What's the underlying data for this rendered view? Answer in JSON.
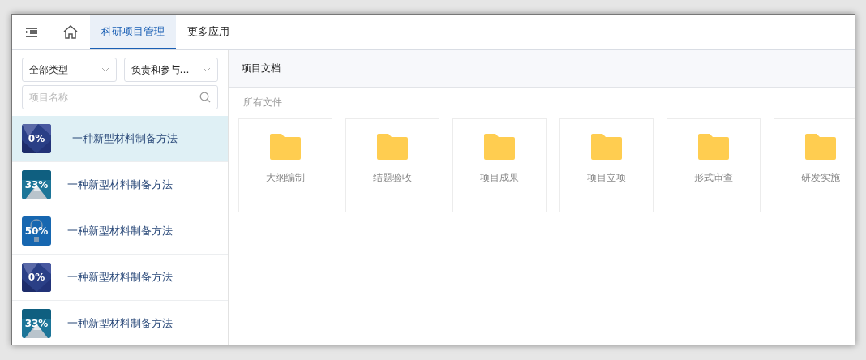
{
  "nav": {
    "tabs": [
      {
        "label": "科研项目管理",
        "selected": true
      },
      {
        "label": "更多应用",
        "selected": false
      }
    ]
  },
  "sidebar": {
    "filters": [
      {
        "value": "全部类型"
      },
      {
        "value": "负责和参与…"
      }
    ],
    "search": {
      "placeholder": "项目名称"
    },
    "projects": [
      {
        "name": "一种新型材料制备方法",
        "progress": "0%",
        "kind": "polygon",
        "selected": true
      },
      {
        "name": "一种新型材料制备方法",
        "progress": "33%",
        "kind": "mountain",
        "selected": false
      },
      {
        "name": "一种新型材料制备方法",
        "progress": "50%",
        "kind": "bulb",
        "selected": false
      },
      {
        "name": "一种新型材料制备方法",
        "progress": "0%",
        "kind": "polygon",
        "selected": false
      },
      {
        "name": "一种新型材料制备方法",
        "progress": "33%",
        "kind": "mountain",
        "selected": false
      }
    ]
  },
  "content": {
    "title": "项目文档",
    "breadcrumb": "所有文件",
    "folders": [
      {
        "name": "大纲编制"
      },
      {
        "name": "结题验收"
      },
      {
        "name": "项目成果"
      },
      {
        "name": "项目立项"
      },
      {
        "name": "形式审查"
      },
      {
        "name": "研发实施"
      }
    ]
  }
}
